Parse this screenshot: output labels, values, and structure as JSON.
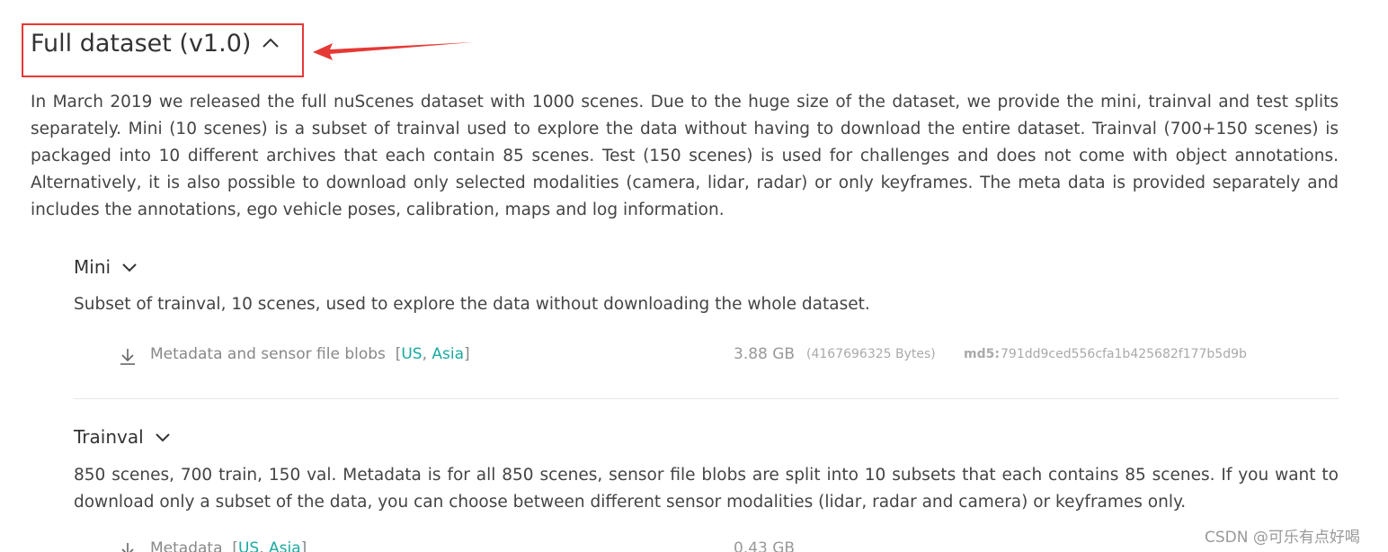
{
  "full_dataset": {
    "title": "Full dataset (v1.0)",
    "intro": "In March 2019 we released the full nuScenes dataset with 1000 scenes. Due to the huge size of the dataset, we provide the mini, trainval and test splits separately. Mini (10 scenes) is a subset of trainval used to explore the data without having to download the entire dataset. Trainval (700+150 scenes) is packaged into 10 different archives that each contain 85 scenes. Test (150 scenes) is used for challenges and does not come with object annotations. Alternatively, it is also possible to download only selected modalities (camera, lidar, radar) or only keyframes. The meta data is provided separately and includes the annotations, ego vehicle poses, calibration, maps and log information."
  },
  "mini": {
    "title": "Mini",
    "description": "Subset of trainval, 10 scenes, used to explore the data without downloading the whole dataset.",
    "file": {
      "name": "Metadata and sensor file blobs",
      "region_us": "US",
      "region_asia": "Asia",
      "size": "3.88 GB",
      "bytes": "(4167696325 Bytes)",
      "md5_label": "md5:",
      "md5_value": "791dd9ced556cfa1b425682f177b5d9b"
    }
  },
  "trainval": {
    "title": "Trainval",
    "description": "850 scenes, 700 train, 150 val. Metadata is for all 850 scenes, sensor file blobs are split into 10 subsets that each contains 85 scenes. If you want to download only a subset of the data, you can choose between different sensor modalities (lidar, radar and camera) or keyframes only.",
    "file": {
      "name": "Metadata",
      "region_us": "US",
      "region_asia": "Asia",
      "size": "0.43 GB"
    }
  },
  "watermark": "CSDN @可乐有点好喝",
  "colors": {
    "accent_link": "#1ba9a0",
    "highlight": "#e53935",
    "text": "#333333"
  },
  "icons": {
    "collapse": "chevron-up-icon",
    "expand": "chevron-down-icon",
    "download": "download-icon",
    "annotation": "red-arrow-icon"
  }
}
